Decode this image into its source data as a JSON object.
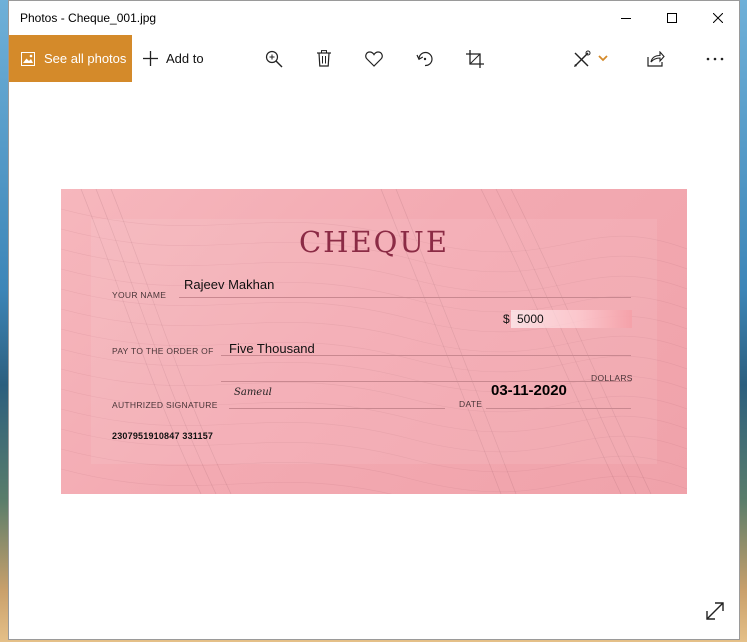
{
  "window": {
    "title": "Photos - Cheque_001.jpg",
    "controls": [
      "minimize-icon",
      "maximize-icon",
      "close-icon"
    ]
  },
  "toolbar": {
    "see_all_label": "See all photos",
    "add_to_label": "Add to",
    "accent_color": "#d48a2a",
    "icons": [
      "zoom-in-icon",
      "delete-icon",
      "favorite-icon",
      "rotate-icon",
      "crop-icon",
      "edit-create-icon",
      "share-icon",
      "more-icon"
    ]
  },
  "cheque": {
    "title": "CHEQUE",
    "your_name_label": "YOUR NAME",
    "your_name_value": "Rajeev Makhan",
    "currency": "$",
    "amount": "5000",
    "pay_to_label": "PAY TO THE ORDER OF",
    "pay_to_value": "Five Thousand",
    "dollars_label": "DOLLARS",
    "signature_label": "AUTHRIZED SIGNATURE",
    "signature_value": "Sameul",
    "date_label": "DATE",
    "date_value": "03-11-2020",
    "micr_line": "2307951910847  331157"
  }
}
